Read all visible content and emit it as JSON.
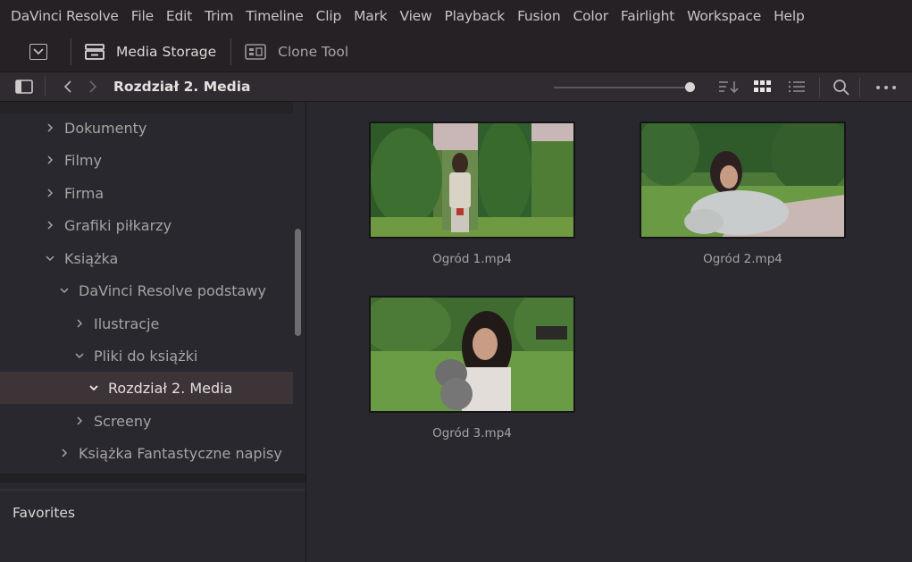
{
  "menubar": {
    "items": [
      "DaVinci Resolve",
      "File",
      "Edit",
      "Trim",
      "Timeline",
      "Clip",
      "Mark",
      "View",
      "Playback",
      "Fusion",
      "Color",
      "Fairlight",
      "Workspace",
      "Help"
    ]
  },
  "toolbar": {
    "media_storage_label": "Media Storage",
    "clone_tool_label": "Clone Tool"
  },
  "pathbar": {
    "current_bin": "Rozdział 2. Media"
  },
  "sidebar": {
    "tree": [
      {
        "label": "Dokumenty",
        "expanded": false,
        "level": 1
      },
      {
        "label": "Filmy",
        "expanded": false,
        "level": 1
      },
      {
        "label": "Firma",
        "expanded": false,
        "level": 1
      },
      {
        "label": "Grafiki piłkarzy",
        "expanded": false,
        "level": 1
      },
      {
        "label": "Książka",
        "expanded": true,
        "level": 1
      },
      {
        "label": "DaVinci Resolve podstawy",
        "expanded": true,
        "level": 2
      },
      {
        "label": "Ilustracje",
        "expanded": false,
        "level": 3
      },
      {
        "label": "Pliki do książki",
        "expanded": true,
        "level": 3
      },
      {
        "label": "Rozdział 2. Media",
        "expanded": true,
        "level": 4,
        "selected": true
      },
      {
        "label": "Screeny",
        "expanded": false,
        "level": 3
      },
      {
        "label": "Książka Fantastyczne napisy",
        "expanded": false,
        "level": 2
      }
    ],
    "favorites_label": "Favorites"
  },
  "media_pool": {
    "clips": [
      {
        "name": "Ogród 1.mp4"
      },
      {
        "name": "Ogród 2.mp4"
      },
      {
        "name": "Ogród 3.mp4"
      }
    ]
  },
  "colors": {
    "menubar_bg": "#262125",
    "panel_bg": "#28282e",
    "selected_row": "#3c3436",
    "text": "#a8a3a4"
  }
}
